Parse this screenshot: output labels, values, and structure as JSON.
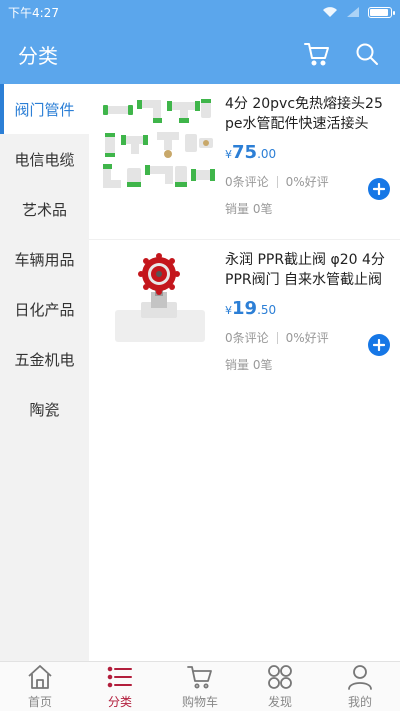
{
  "statusbar": {
    "time": "下午4:27"
  },
  "header": {
    "title": "分类",
    "icons": [
      "cart-icon",
      "search-icon"
    ]
  },
  "sidebar": {
    "active_index": 0,
    "items": [
      {
        "label": "阀门管件"
      },
      {
        "label": "电信电缆"
      },
      {
        "label": "艺术品"
      },
      {
        "label": "车辆用品"
      },
      {
        "label": "日化产品"
      },
      {
        "label": "五金机电"
      },
      {
        "label": "陶瓷"
      }
    ]
  },
  "products": [
    {
      "name": "4分 20pvc免热熔接头25pe水管配件快速活接头",
      "currency": "¥",
      "price_int": "75",
      "price_dec": ".00",
      "reviews": "0条评论",
      "rating": "0%好评",
      "sales": "销量 0笔"
    },
    {
      "name": "永润 PPR截止阀 φ20 4分 PPR阀门 自来水管截止阀",
      "currency": "¥",
      "price_int": "19",
      "price_dec": ".50",
      "reviews": "0条评论",
      "rating": "0%好评",
      "sales": "销量 0笔"
    }
  ],
  "tabbar": {
    "active_index": 1,
    "items": [
      {
        "label": "首页",
        "icon": "home-icon"
      },
      {
        "label": "分类",
        "icon": "list-icon"
      },
      {
        "label": "购物车",
        "icon": "cart-icon"
      },
      {
        "label": "发现",
        "icon": "discover-icon"
      },
      {
        "label": "我的",
        "icon": "user-icon"
      }
    ]
  },
  "colors": {
    "header": "#5ba6ec",
    "accent": "#2c7fd6",
    "tab_active": "#b21e3c"
  }
}
